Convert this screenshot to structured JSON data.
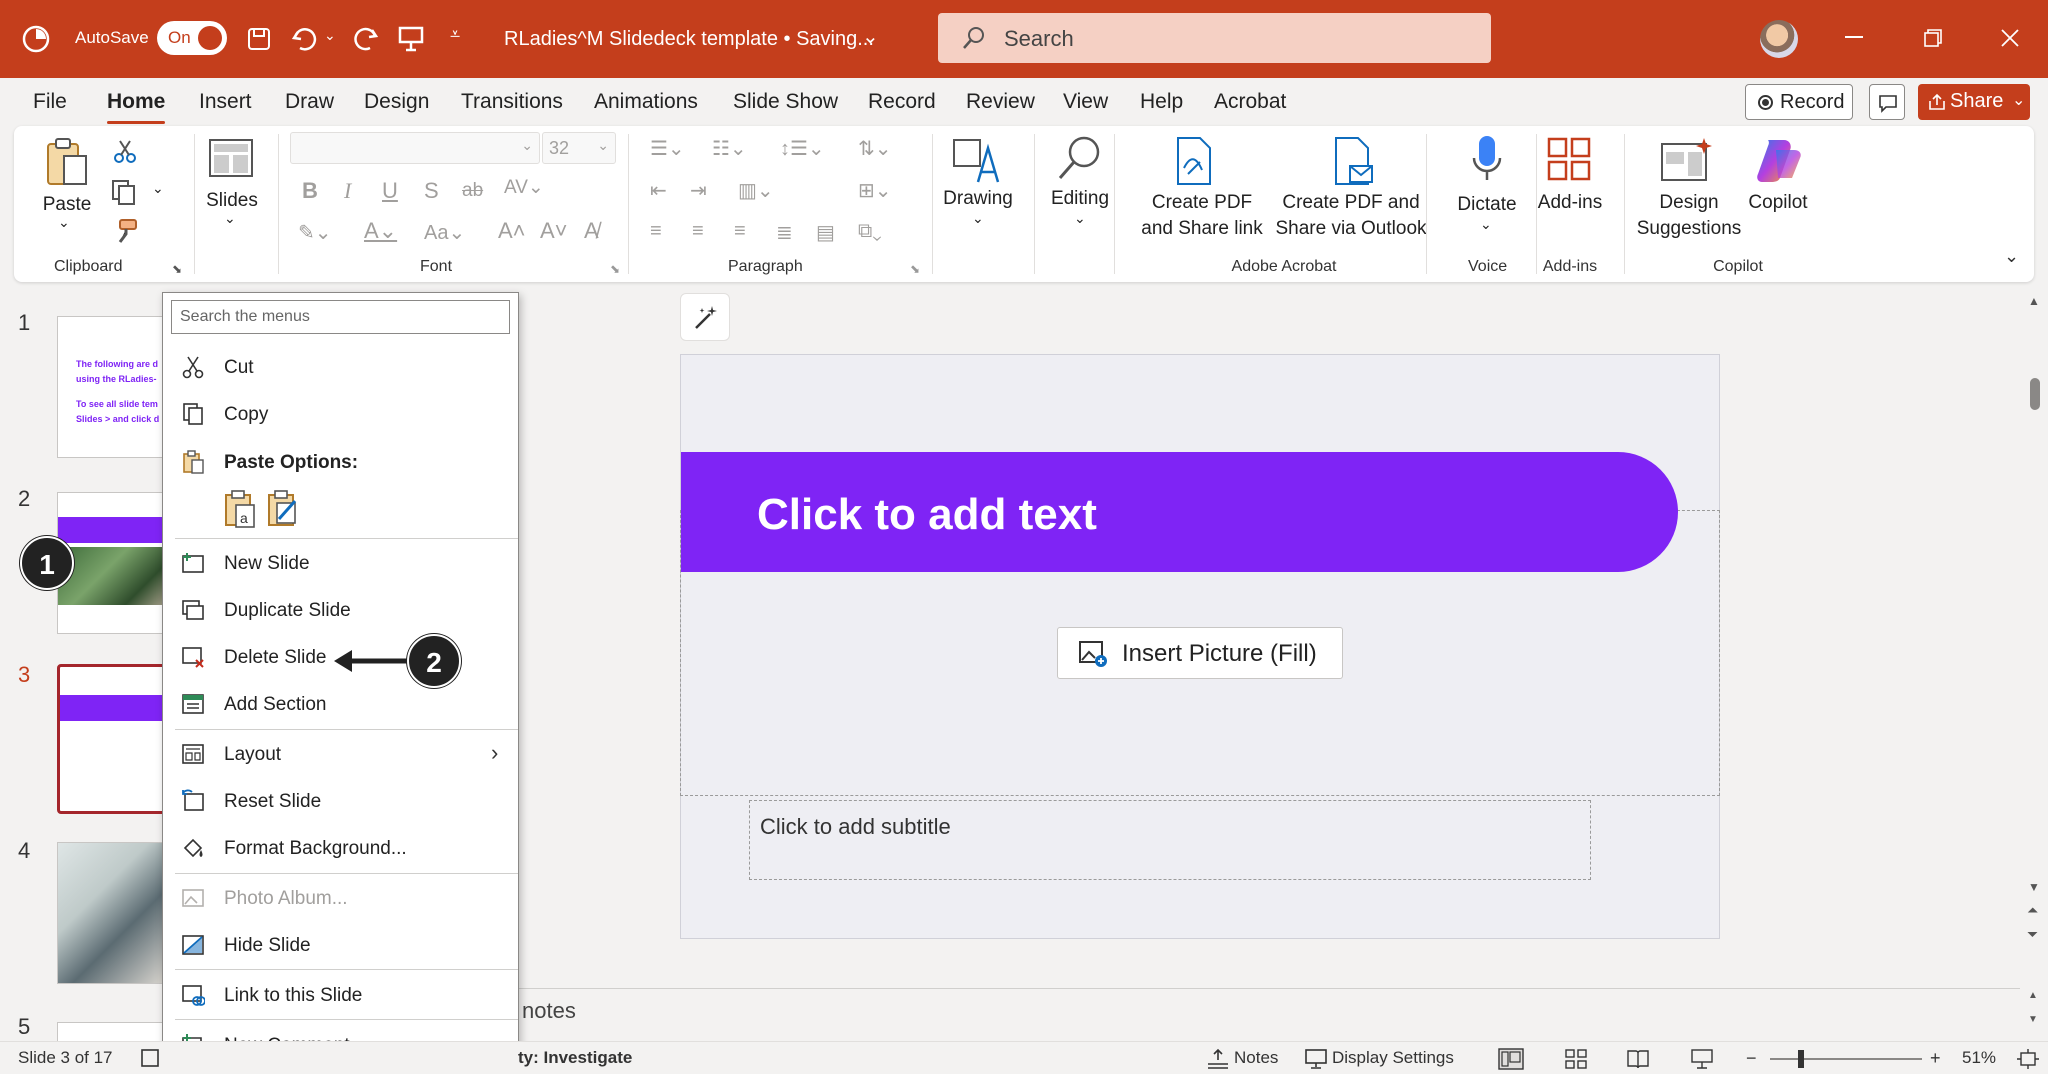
{
  "titlebar": {
    "autosave_label": "AutoSave",
    "autosave_state": "On",
    "doc_title": "RLadies^M Slidedeck template • Saving...",
    "search_placeholder": "Search",
    "icons": [
      "powerpoint-logo-icon",
      "save-icon",
      "undo-icon",
      "redo-icon",
      "present-icon",
      "customize-qat-icon",
      "minimize-icon",
      "restore-icon",
      "close-icon"
    ]
  },
  "menubar": {
    "tabs": [
      "File",
      "Home",
      "Insert",
      "Draw",
      "Design",
      "Transitions",
      "Animations",
      "Slide Show",
      "Record",
      "Review",
      "View",
      "Help",
      "Acrobat"
    ],
    "active": "Home",
    "record_label": "Record",
    "share_label": "Share"
  },
  "ribbon": {
    "clipboard": {
      "paste": "Paste",
      "group": "Clipboard"
    },
    "slides": {
      "label": "Slides"
    },
    "font": {
      "size": "32",
      "group": "Font"
    },
    "paragraph": {
      "group": "Paragraph"
    },
    "drawing": "Drawing",
    "editing": "Editing",
    "acrobat": {
      "btn1_line1": "Create PDF",
      "btn1_line2": "and Share link",
      "btn2_line1": "Create PDF and",
      "btn2_line2": "Share via Outlook",
      "group": "Adobe Acrobat"
    },
    "voice": {
      "dictate": "Dictate",
      "group": "Voice"
    },
    "addins": {
      "label": "Add-ins",
      "group": "Add-ins"
    },
    "copilot": {
      "design_line1": "Design",
      "design_line2": "Suggestions",
      "copilot": "Copilot",
      "group": "Copilot"
    }
  },
  "thumbnails": {
    "numbers": [
      "1",
      "2",
      "3",
      "4",
      "5"
    ],
    "slide1_lines": [
      "The following are d",
      "using the RLadies-",
      "To see all slide tem",
      "Slides > and click d"
    ],
    "accent": "#7f24f5",
    "selected_color": "#a4262c"
  },
  "context_menu": {
    "search_placeholder": "Search the menus",
    "items": {
      "cut": "Cut",
      "copy": "Copy",
      "paste_options": "Paste Options:",
      "new_slide": "New Slide",
      "duplicate_slide": "Duplicate Slide",
      "delete_slide": "Delete Slide",
      "add_section": "Add Section",
      "layout": "Layout",
      "reset_slide": "Reset Slide",
      "format_background": "Format Background...",
      "photo_album": "Photo Album...",
      "hide_slide": "Hide Slide",
      "link_to_slide": "Link to this Slide",
      "new_comment": "New Comment"
    }
  },
  "slide": {
    "title_placeholder": "Click to add text",
    "insert_picture": "Insert Picture (Fill)",
    "subtitle_placeholder": "Click to add subtitle",
    "banner_color": "#7f24f5"
  },
  "notes": {
    "label": "notes"
  },
  "statusbar": {
    "slide_info": "Slide 3 of 17",
    "accessibility": "ty: Investigate",
    "notes": "Notes",
    "display_settings": "Display Settings",
    "zoom": "51%"
  },
  "annotations": {
    "badge1": "1",
    "badge2": "2"
  },
  "colors": {
    "brand": "#c43e1c",
    "purple": "#7f24f5"
  }
}
